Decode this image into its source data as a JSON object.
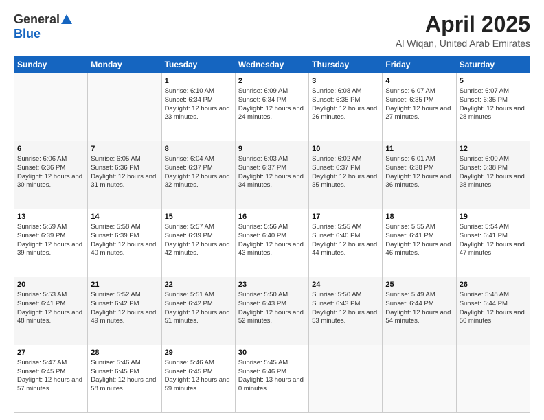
{
  "header": {
    "logo_general": "General",
    "logo_blue": "Blue",
    "month_title": "April 2025",
    "location": "Al Wiqan, United Arab Emirates"
  },
  "days_of_week": [
    "Sunday",
    "Monday",
    "Tuesday",
    "Wednesday",
    "Thursday",
    "Friday",
    "Saturday"
  ],
  "weeks": [
    [
      {
        "day": "",
        "content": ""
      },
      {
        "day": "",
        "content": ""
      },
      {
        "day": "1",
        "content": "Sunrise: 6:10 AM\nSunset: 6:34 PM\nDaylight: 12 hours and 23 minutes."
      },
      {
        "day": "2",
        "content": "Sunrise: 6:09 AM\nSunset: 6:34 PM\nDaylight: 12 hours and 24 minutes."
      },
      {
        "day": "3",
        "content": "Sunrise: 6:08 AM\nSunset: 6:35 PM\nDaylight: 12 hours and 26 minutes."
      },
      {
        "day": "4",
        "content": "Sunrise: 6:07 AM\nSunset: 6:35 PM\nDaylight: 12 hours and 27 minutes."
      },
      {
        "day": "5",
        "content": "Sunrise: 6:07 AM\nSunset: 6:35 PM\nDaylight: 12 hours and 28 minutes."
      }
    ],
    [
      {
        "day": "6",
        "content": "Sunrise: 6:06 AM\nSunset: 6:36 PM\nDaylight: 12 hours and 30 minutes."
      },
      {
        "day": "7",
        "content": "Sunrise: 6:05 AM\nSunset: 6:36 PM\nDaylight: 12 hours and 31 minutes."
      },
      {
        "day": "8",
        "content": "Sunrise: 6:04 AM\nSunset: 6:37 PM\nDaylight: 12 hours and 32 minutes."
      },
      {
        "day": "9",
        "content": "Sunrise: 6:03 AM\nSunset: 6:37 PM\nDaylight: 12 hours and 34 minutes."
      },
      {
        "day": "10",
        "content": "Sunrise: 6:02 AM\nSunset: 6:37 PM\nDaylight: 12 hours and 35 minutes."
      },
      {
        "day": "11",
        "content": "Sunrise: 6:01 AM\nSunset: 6:38 PM\nDaylight: 12 hours and 36 minutes."
      },
      {
        "day": "12",
        "content": "Sunrise: 6:00 AM\nSunset: 6:38 PM\nDaylight: 12 hours and 38 minutes."
      }
    ],
    [
      {
        "day": "13",
        "content": "Sunrise: 5:59 AM\nSunset: 6:39 PM\nDaylight: 12 hours and 39 minutes."
      },
      {
        "day": "14",
        "content": "Sunrise: 5:58 AM\nSunset: 6:39 PM\nDaylight: 12 hours and 40 minutes."
      },
      {
        "day": "15",
        "content": "Sunrise: 5:57 AM\nSunset: 6:39 PM\nDaylight: 12 hours and 42 minutes."
      },
      {
        "day": "16",
        "content": "Sunrise: 5:56 AM\nSunset: 6:40 PM\nDaylight: 12 hours and 43 minutes."
      },
      {
        "day": "17",
        "content": "Sunrise: 5:55 AM\nSunset: 6:40 PM\nDaylight: 12 hours and 44 minutes."
      },
      {
        "day": "18",
        "content": "Sunrise: 5:55 AM\nSunset: 6:41 PM\nDaylight: 12 hours and 46 minutes."
      },
      {
        "day": "19",
        "content": "Sunrise: 5:54 AM\nSunset: 6:41 PM\nDaylight: 12 hours and 47 minutes."
      }
    ],
    [
      {
        "day": "20",
        "content": "Sunrise: 5:53 AM\nSunset: 6:41 PM\nDaylight: 12 hours and 48 minutes."
      },
      {
        "day": "21",
        "content": "Sunrise: 5:52 AM\nSunset: 6:42 PM\nDaylight: 12 hours and 49 minutes."
      },
      {
        "day": "22",
        "content": "Sunrise: 5:51 AM\nSunset: 6:42 PM\nDaylight: 12 hours and 51 minutes."
      },
      {
        "day": "23",
        "content": "Sunrise: 5:50 AM\nSunset: 6:43 PM\nDaylight: 12 hours and 52 minutes."
      },
      {
        "day": "24",
        "content": "Sunrise: 5:50 AM\nSunset: 6:43 PM\nDaylight: 12 hours and 53 minutes."
      },
      {
        "day": "25",
        "content": "Sunrise: 5:49 AM\nSunset: 6:44 PM\nDaylight: 12 hours and 54 minutes."
      },
      {
        "day": "26",
        "content": "Sunrise: 5:48 AM\nSunset: 6:44 PM\nDaylight: 12 hours and 56 minutes."
      }
    ],
    [
      {
        "day": "27",
        "content": "Sunrise: 5:47 AM\nSunset: 6:45 PM\nDaylight: 12 hours and 57 minutes."
      },
      {
        "day": "28",
        "content": "Sunrise: 5:46 AM\nSunset: 6:45 PM\nDaylight: 12 hours and 58 minutes."
      },
      {
        "day": "29",
        "content": "Sunrise: 5:46 AM\nSunset: 6:45 PM\nDaylight: 12 hours and 59 minutes."
      },
      {
        "day": "30",
        "content": "Sunrise: 5:45 AM\nSunset: 6:46 PM\nDaylight: 13 hours and 0 minutes."
      },
      {
        "day": "",
        "content": ""
      },
      {
        "day": "",
        "content": ""
      },
      {
        "day": "",
        "content": ""
      }
    ]
  ]
}
